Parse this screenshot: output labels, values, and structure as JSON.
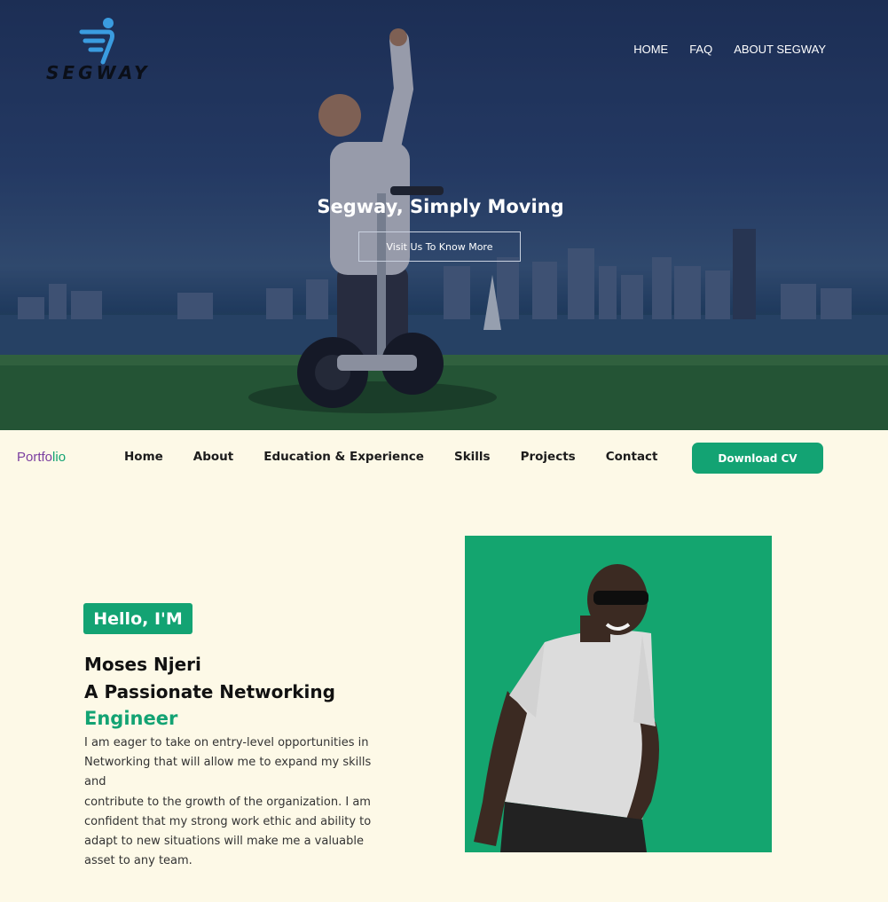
{
  "hero": {
    "logo_text": "SEGWAY",
    "nav": [
      "HOME",
      "FAQ",
      "ABOUT SEGWAY"
    ],
    "title": "Segway, Simply Moving",
    "cta_label": "Visit Us To Know More"
  },
  "portfolio_nav": {
    "brand_part1": "Portfo",
    "brand_part2": "lio",
    "links": [
      "Home",
      "About",
      "Education & Experience",
      "Skills",
      "Projects",
      "Contact"
    ],
    "cv_button": "Download CV"
  },
  "intro": {
    "greeting": "Hello, I'M",
    "name": "Moses Njeri",
    "role_line": "A Passionate Networking",
    "role_accent": "Engineer",
    "bio_lines": [
      "I am eager to take on entry-level opportunities in",
      "Networking that will allow me to expand my skills and",
      "contribute to the growth of the organization. I am",
      "confident that my strong work ethic and ability to",
      "adapt to new situations will make me a valuable",
      "asset to any team."
    ]
  },
  "colors": {
    "accent": "#13a373",
    "brand_purple": "#7b3fa0",
    "page_bg": "#fdf9e7"
  }
}
